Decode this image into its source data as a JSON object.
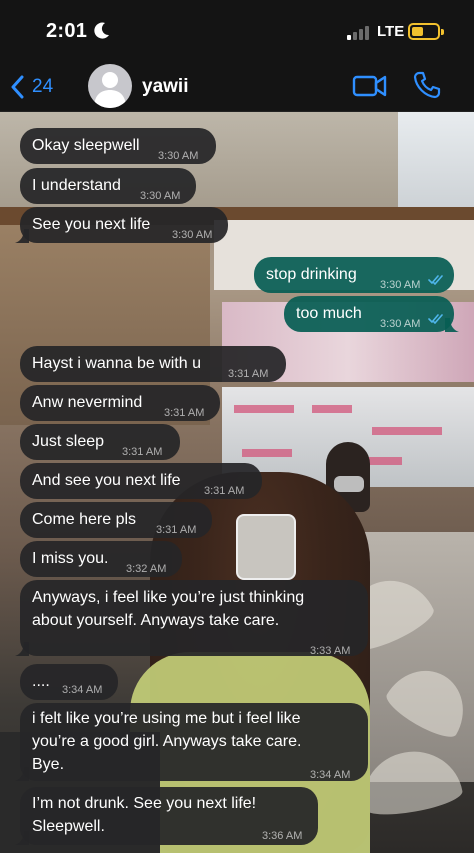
{
  "status_bar": {
    "time": "2:01",
    "carrier": "LTE"
  },
  "nav": {
    "back_count": "24",
    "contact_name": "yawii",
    "icons": [
      "chevron-left-icon",
      "video-camera-icon",
      "phone-icon"
    ]
  },
  "colors": {
    "accent": "#2f8fff",
    "incoming_bubble": "#262628",
    "outgoing_bubble": "#075e54",
    "read_ticks": "#4fb6ec",
    "battery": "#f2c12e"
  },
  "messages": [
    {
      "direction": "in",
      "text": "Okay sleepwell",
      "time": "3:30 AM"
    },
    {
      "direction": "in",
      "text": "I understand",
      "time": "3:30 AM"
    },
    {
      "direction": "in",
      "text": "See you next life",
      "time": "3:30 AM"
    },
    {
      "direction": "out",
      "text": "stop drinking",
      "time": "3:30 AM",
      "status": "read"
    },
    {
      "direction": "out",
      "text": "too much",
      "time": "3:30 AM",
      "status": "read"
    },
    {
      "direction": "in",
      "text": "Hayst i wanna be with u",
      "time": "3:31 AM"
    },
    {
      "direction": "in",
      "text": "Anw nevermind",
      "time": "3:31 AM"
    },
    {
      "direction": "in",
      "text": "Just sleep",
      "time": "3:31 AM"
    },
    {
      "direction": "in",
      "text": "And see you next life",
      "time": "3:31 AM"
    },
    {
      "direction": "in",
      "text": "Come here pls",
      "time": "3:31 AM"
    },
    {
      "direction": "in",
      "text": "I miss you.",
      "time": "3:32 AM"
    },
    {
      "direction": "in",
      "lines": [
        "Anyways, i feel like you’re just thinking",
        "about yourself. Anyways take care."
      ],
      "time": "3:33 AM"
    },
    {
      "direction": "in",
      "text": "....",
      "time": "3:34 AM"
    },
    {
      "direction": "in",
      "lines": [
        "i felt like you’re using me but i feel like",
        "you’re a good girl. Anyways take care.",
        "Bye."
      ],
      "time": "3:34 AM"
    },
    {
      "direction": "in",
      "lines": [
        "I’m not drunk. See you next life!",
        "Sleepwell."
      ],
      "time": "3:36 AM"
    }
  ]
}
